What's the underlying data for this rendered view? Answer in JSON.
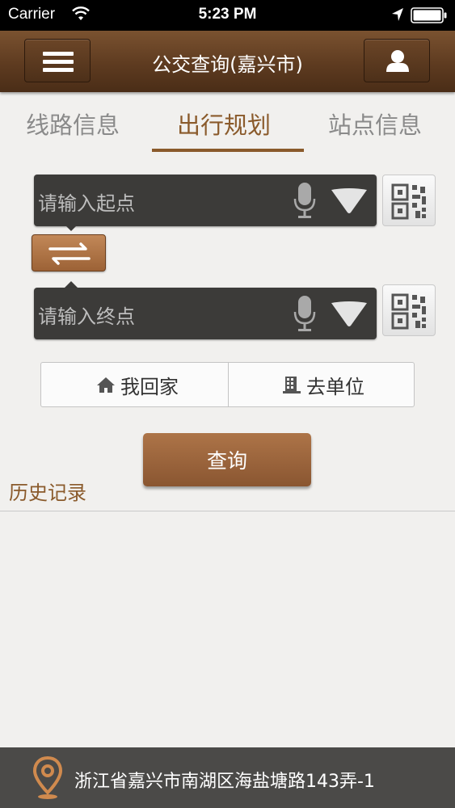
{
  "status_bar": {
    "carrier": "Carrier",
    "time": "5:23 PM"
  },
  "nav": {
    "title": "公交查询(嘉兴市)",
    "menu_icon": "hamburger-menu-icon",
    "user_icon": "user-icon"
  },
  "tabs": [
    {
      "label": "线路信息",
      "active": false
    },
    {
      "label": "出行规划",
      "active": true
    },
    {
      "label": "站点信息",
      "active": false
    }
  ],
  "planner": {
    "start_placeholder": "请输入起点",
    "end_placeholder": "请输入终点",
    "home_label": "我回家",
    "work_label": "去单位",
    "query_label": "查询"
  },
  "history": {
    "label": "历史记录"
  },
  "footer": {
    "address": "浙江省嘉兴市南湖区海盐塘路143弄-1"
  },
  "colors": {
    "brand_brown": "#8a5a2b",
    "nav_brown": "#5e3b20",
    "input_dark": "#3c3b39"
  }
}
